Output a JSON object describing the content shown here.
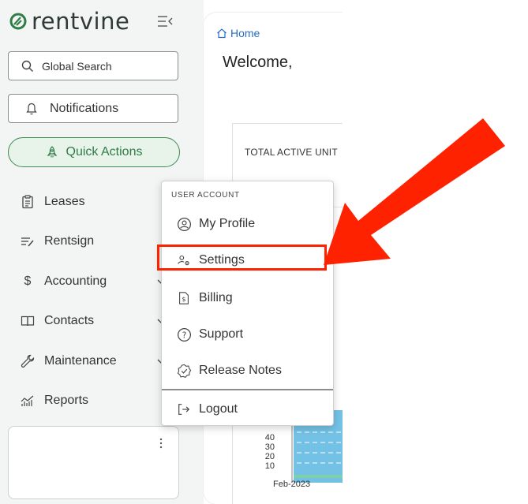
{
  "brand": {
    "name": "rentvine",
    "accent": "#3a8a52"
  },
  "sidebar": {
    "search": {
      "label": "Global Search",
      "icon": "search-icon"
    },
    "notifications": {
      "label": "Notifications",
      "icon": "bell-icon"
    },
    "quick_actions": {
      "label": "Quick Actions",
      "icon": "rocket-icon"
    },
    "items": [
      {
        "label": "Leases",
        "icon": "lease-icon"
      },
      {
        "label": "Rentsign",
        "icon": "rentsign-icon"
      },
      {
        "label": "Accounting",
        "icon": "dollar-icon"
      },
      {
        "label": "Contacts",
        "icon": "contacts-icon"
      },
      {
        "label": "Maintenance",
        "icon": "wrench-icon"
      },
      {
        "label": "Reports",
        "icon": "chart-icon"
      }
    ]
  },
  "main": {
    "breadcrumb": "Home",
    "welcome": "Welcome,",
    "card_title": "TOTAL ACTIVE UNIT",
    "chart_ticks": [
      "40",
      "30",
      "20",
      "10"
    ],
    "chart_xlabel": "Feb-2023"
  },
  "user_menu": {
    "header": "USER ACCOUNT",
    "items": [
      {
        "label": "My Profile",
        "icon": "user-circle-icon"
      },
      {
        "label": "Settings",
        "icon": "user-settings-icon"
      },
      {
        "label": "Billing",
        "icon": "invoice-icon"
      },
      {
        "label": "Support",
        "icon": "help-icon"
      },
      {
        "label": "Release Notes",
        "icon": "badge-check-icon"
      },
      {
        "label": "Logout",
        "icon": "logout-icon"
      }
    ]
  },
  "annotation": {
    "highlight_color": "#ff2200"
  }
}
